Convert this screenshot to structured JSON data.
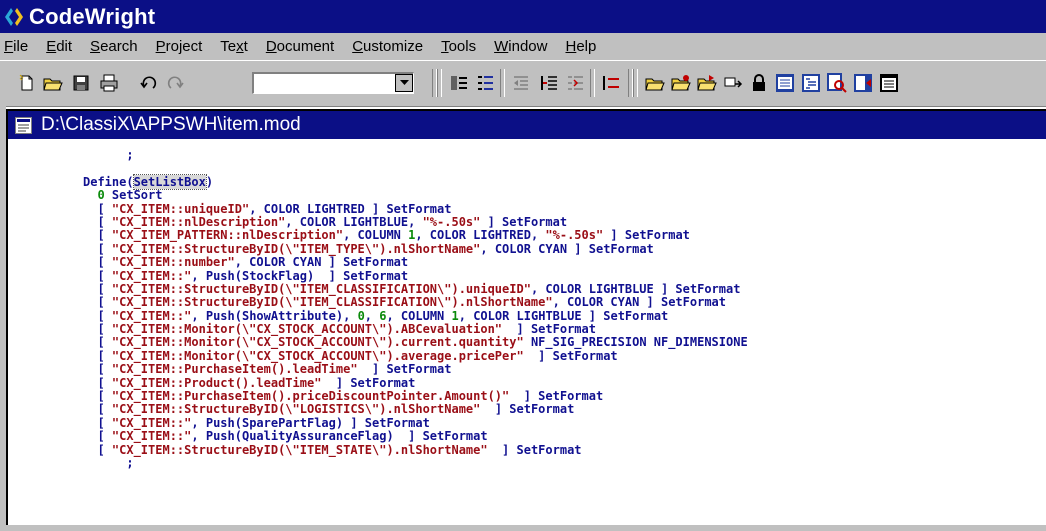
{
  "app": {
    "title": "CodeWright",
    "title_bar_color": "#0b0f86",
    "icon": "codewright-logo-icon"
  },
  "menu": [
    {
      "key": "file",
      "label": "File",
      "accel": "F",
      "rest": "ile"
    },
    {
      "key": "edit",
      "label": "Edit",
      "accel": "E",
      "rest": "dit"
    },
    {
      "key": "search",
      "label": "Search",
      "accel": "S",
      "rest": "earch"
    },
    {
      "key": "project",
      "label": "Project",
      "accel": "P",
      "rest": "roject"
    },
    {
      "key": "text",
      "label": "Text",
      "pre": "Te",
      "accel": "x",
      "rest": "t"
    },
    {
      "key": "document",
      "label": "Document",
      "accel": "D",
      "rest": "ocument"
    },
    {
      "key": "customize",
      "label": "Customize",
      "accel": "C",
      "rest": "ustomize"
    },
    {
      "key": "tools",
      "label": "Tools",
      "accel": "T",
      "rest": "ools"
    },
    {
      "key": "window",
      "label": "Window",
      "accel": "W",
      "rest": "indow"
    },
    {
      "key": "help",
      "label": "Help",
      "accel": "H",
      "rest": "elp"
    }
  ],
  "toolbar": {
    "combo_value": "",
    "icons": [
      "new-file-icon",
      "open-file-icon",
      "save-icon",
      "print-icon",
      "undo-icon",
      "redo-icon",
      "numbering-icon",
      "bullets-icon",
      "outdent-icon",
      "indent-icon",
      "align-icon",
      "list-icon",
      "open-folder-icon",
      "open-project-icon",
      "open-recent-icon",
      "transfer-icon",
      "lock-icon",
      "browse-icon",
      "outline-icon",
      "find-icon",
      "bookmark-icon",
      "window-icon"
    ]
  },
  "document": {
    "title": "D:\\ClassiX\\APPSWH\\item.mod",
    "icon": "document-icon",
    "colors": {
      "keyword": "#101090",
      "string": "#9a0e16",
      "number": "#0a8a0a",
      "background": "#ffffff"
    }
  },
  "code_lines": [
    [
      {
        "t": "      ;",
        "c": "kw"
      }
    ],
    [
      {
        "t": "",
        "c": "kw"
      }
    ],
    [
      {
        "t": "Define(",
        "c": "kw"
      },
      {
        "t": "SetListBox",
        "c": "sel"
      },
      {
        "t": ")",
        "c": "kw"
      }
    ],
    [
      {
        "t": "  ",
        "c": "kw"
      },
      {
        "t": "0",
        "c": "num"
      },
      {
        "t": " SetSort",
        "c": "kw"
      }
    ],
    [
      {
        "t": "  [ ",
        "c": "kw"
      },
      {
        "t": "\"CX_ITEM::uniqueID\"",
        "c": "str"
      },
      {
        "t": ", COLOR LIGHTRED ] SetFormat",
        "c": "kw"
      }
    ],
    [
      {
        "t": "  [ ",
        "c": "kw"
      },
      {
        "t": "\"CX_ITEM::nlDescription\"",
        "c": "str"
      },
      {
        "t": ", COLOR LIGHTBLUE, ",
        "c": "kw"
      },
      {
        "t": "\"%-.50s\"",
        "c": "str"
      },
      {
        "t": " ] SetFormat",
        "c": "kw"
      }
    ],
    [
      {
        "t": "  [ ",
        "c": "kw"
      },
      {
        "t": "\"CX_ITEM_PATTERN::nlDescription\"",
        "c": "str"
      },
      {
        "t": ", COLUMN ",
        "c": "kw"
      },
      {
        "t": "1",
        "c": "num"
      },
      {
        "t": ", COLOR LIGHTRED, ",
        "c": "kw"
      },
      {
        "t": "\"%-.50s\"",
        "c": "str"
      },
      {
        "t": " ] SetFormat",
        "c": "kw"
      }
    ],
    [
      {
        "t": "  [ ",
        "c": "kw"
      },
      {
        "t": "\"CX_ITEM::StructureByID(\\\"ITEM_TYPE\\\").nlShortName\"",
        "c": "str"
      },
      {
        "t": ", COLOR CYAN ] SetFormat",
        "c": "kw"
      }
    ],
    [
      {
        "t": "  [ ",
        "c": "kw"
      },
      {
        "t": "\"CX_ITEM::number\"",
        "c": "str"
      },
      {
        "t": ", COLOR CYAN ] SetFormat",
        "c": "kw"
      }
    ],
    [
      {
        "t": "  [ ",
        "c": "kw"
      },
      {
        "t": "\"CX_ITEM::\"",
        "c": "str"
      },
      {
        "t": ", Push(StockFlag)  ] SetFormat",
        "c": "kw"
      }
    ],
    [
      {
        "t": "  [ ",
        "c": "kw"
      },
      {
        "t": "\"CX_ITEM::StructureByID(\\\"ITEM_CLASSIFICATION\\\").uniqueID\"",
        "c": "str"
      },
      {
        "t": ", COLOR LIGHTBLUE ] SetFormat",
        "c": "kw"
      }
    ],
    [
      {
        "t": "  [ ",
        "c": "kw"
      },
      {
        "t": "\"CX_ITEM::StructureByID(\\\"ITEM_CLASSIFICATION\\\").nlShortName\"",
        "c": "str"
      },
      {
        "t": ", COLOR CYAN ] SetFormat",
        "c": "kw"
      }
    ],
    [
      {
        "t": "  [ ",
        "c": "kw"
      },
      {
        "t": "\"CX_ITEM::\"",
        "c": "str"
      },
      {
        "t": ", Push(ShowAttribute), ",
        "c": "kw"
      },
      {
        "t": "0",
        "c": "num"
      },
      {
        "t": ", ",
        "c": "kw"
      },
      {
        "t": "6",
        "c": "num"
      },
      {
        "t": ", COLUMN ",
        "c": "kw"
      },
      {
        "t": "1",
        "c": "num"
      },
      {
        "t": ", COLOR LIGHTBLUE ] SetFormat",
        "c": "kw"
      }
    ],
    [
      {
        "t": "  [ ",
        "c": "kw"
      },
      {
        "t": "\"CX_ITEM::Monitor(\\\"CX_STOCK_ACCOUNT\\\").ABCevaluation\"",
        "c": "str"
      },
      {
        "t": "  ] SetFormat",
        "c": "kw"
      }
    ],
    [
      {
        "t": "  [ ",
        "c": "kw"
      },
      {
        "t": "\"CX_ITEM::Monitor(\\\"CX_STOCK_ACCOUNT\\\").current.quantity\"",
        "c": "str"
      },
      {
        "t": " NF_SIG_PRECISION NF_DIMENSIONE",
        "c": "kw"
      }
    ],
    [
      {
        "t": "  [ ",
        "c": "kw"
      },
      {
        "t": "\"CX_ITEM::Monitor(\\\"CX_STOCK_ACCOUNT\\\").average.pricePer\"",
        "c": "str"
      },
      {
        "t": "  ] SetFormat",
        "c": "kw"
      }
    ],
    [
      {
        "t": "  [ ",
        "c": "kw"
      },
      {
        "t": "\"CX_ITEM::PurchaseItem().leadTime\"",
        "c": "str"
      },
      {
        "t": "  ] SetFormat",
        "c": "kw"
      }
    ],
    [
      {
        "t": "  [ ",
        "c": "kw"
      },
      {
        "t": "\"CX_ITEM::Product().leadTime\"",
        "c": "str"
      },
      {
        "t": "  ] SetFormat",
        "c": "kw"
      }
    ],
    [
      {
        "t": "  [ ",
        "c": "kw"
      },
      {
        "t": "\"CX_ITEM::PurchaseItem().priceDiscountPointer.Amount()\"",
        "c": "str"
      },
      {
        "t": "  ] SetFormat",
        "c": "kw"
      }
    ],
    [
      {
        "t": "  [ ",
        "c": "kw"
      },
      {
        "t": "\"CX_ITEM::StructureByID(\\\"LOGISTICS\\\").nlShortName\"",
        "c": "str"
      },
      {
        "t": "  ] SetFormat",
        "c": "kw"
      }
    ],
    [
      {
        "t": "  [ ",
        "c": "kw"
      },
      {
        "t": "\"CX_ITEM::\"",
        "c": "str"
      },
      {
        "t": ", Push(SparePartFlag) ] SetFormat",
        "c": "kw"
      }
    ],
    [
      {
        "t": "  [ ",
        "c": "kw"
      },
      {
        "t": "\"CX_ITEM::\"",
        "c": "str"
      },
      {
        "t": ", Push(QualityAssuranceFlag)  ] SetFormat",
        "c": "kw"
      }
    ],
    [
      {
        "t": "  [ ",
        "c": "kw"
      },
      {
        "t": "\"CX_ITEM::StructureByID(\\\"ITEM_STATE\\\").nlShortName\"",
        "c": "str"
      },
      {
        "t": "  ] SetFormat",
        "c": "kw"
      }
    ],
    [
      {
        "t": "      ;",
        "c": "kw"
      }
    ]
  ]
}
